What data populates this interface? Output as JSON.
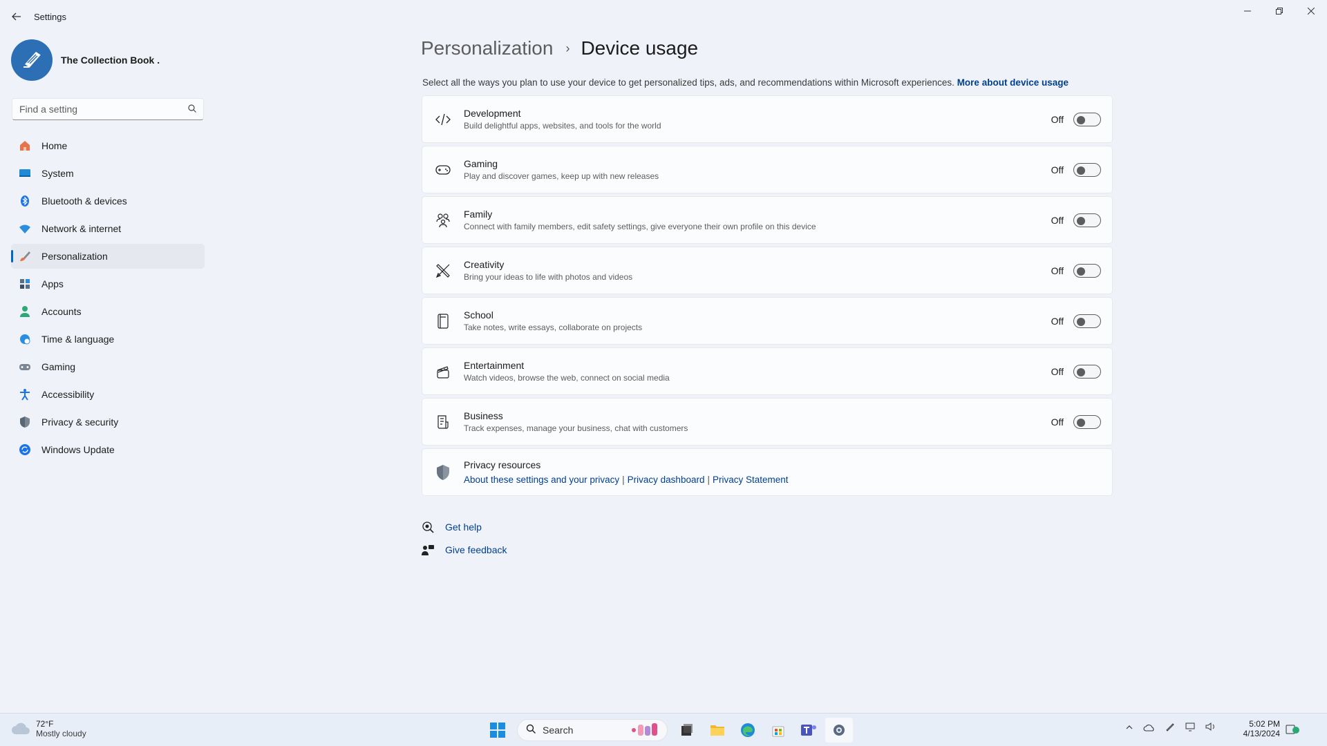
{
  "window": {
    "title": "Settings",
    "back_icon": "back-arrow-icon",
    "minimize_icon": "minimize-icon",
    "maximize_icon": "restore-icon",
    "close_icon": "close-icon"
  },
  "profile": {
    "name": "The Collection Book ."
  },
  "search": {
    "placeholder": "Find a setting"
  },
  "nav": {
    "items": [
      {
        "label": "Home",
        "icon": "home-icon",
        "active": false
      },
      {
        "label": "System",
        "icon": "monitor-icon",
        "active": false
      },
      {
        "label": "Bluetooth & devices",
        "icon": "bluetooth-icon",
        "active": false
      },
      {
        "label": "Network & internet",
        "icon": "wifi-icon",
        "active": false
      },
      {
        "label": "Personalization",
        "icon": "brush-icon",
        "active": true
      },
      {
        "label": "Apps",
        "icon": "apps-icon",
        "active": false
      },
      {
        "label": "Accounts",
        "icon": "person-icon",
        "active": false
      },
      {
        "label": "Time & language",
        "icon": "globe-clock-icon",
        "active": false
      },
      {
        "label": "Gaming",
        "icon": "gamepad-icon",
        "active": false
      },
      {
        "label": "Accessibility",
        "icon": "accessibility-icon",
        "active": false
      },
      {
        "label": "Privacy & security",
        "icon": "shield-icon",
        "active": false
      },
      {
        "label": "Windows Update",
        "icon": "update-icon",
        "active": false
      }
    ]
  },
  "page": {
    "breadcrumb_parent": "Personalization",
    "breadcrumb_sep": "›",
    "breadcrumb_current": "Device usage",
    "intro_text": "Select all the ways you plan to use your device to get personalized tips, ads, and recommendations within Microsoft experiences.",
    "intro_link": "More about device usage"
  },
  "usages": [
    {
      "title": "Development",
      "desc": "Build delightful apps, websites, and tools for the world",
      "icon": "code-icon",
      "state": "Off"
    },
    {
      "title": "Gaming",
      "desc": "Play and discover games, keep up with new releases",
      "icon": "gamepad-icon",
      "state": "Off"
    },
    {
      "title": "Family",
      "desc": "Connect with family members, edit safety settings, give everyone their own profile on this device",
      "icon": "family-icon",
      "state": "Off"
    },
    {
      "title": "Creativity",
      "desc": "Bring your ideas to life with photos and videos",
      "icon": "pen-ruler-icon",
      "state": "Off"
    },
    {
      "title": "School",
      "desc": "Take notes, write essays, collaborate on projects",
      "icon": "notebook-icon",
      "state": "Off"
    },
    {
      "title": "Entertainment",
      "desc": "Watch videos, browse the web, connect on social media",
      "icon": "clapperboard-icon",
      "state": "Off"
    },
    {
      "title": "Business",
      "desc": "Track expenses, manage your business, chat with customers",
      "icon": "receipt-icon",
      "state": "Off"
    }
  ],
  "privacy": {
    "title": "Privacy resources",
    "icon": "shield-icon",
    "links": [
      "About these settings and your privacy",
      "Privacy dashboard",
      "Privacy Statement"
    ],
    "sep": "|"
  },
  "help": {
    "get_help": "Get help",
    "give_feedback": "Give feedback"
  },
  "taskbar": {
    "weather_temp": "72°F",
    "weather_desc": "Mostly cloudy",
    "search_label": "Search",
    "time": "5:02 PM",
    "date": "4/13/2024"
  },
  "colors": {
    "accent": "#0067c0",
    "link": "#003e92",
    "background": "#eff3f9",
    "card": "#fbfcfe"
  }
}
